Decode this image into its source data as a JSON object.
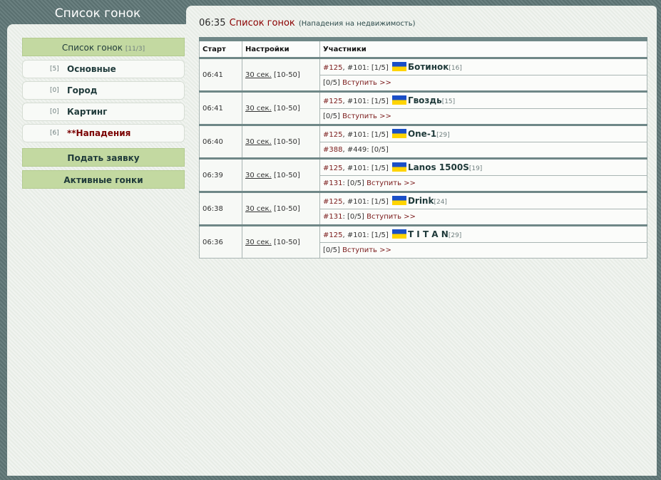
{
  "left_title": "Список гонок",
  "menu": {
    "race_list": {
      "label": "Список гонок",
      "count": "[11/3]"
    },
    "items": [
      {
        "count": "[5]",
        "label": "Основные"
      },
      {
        "count": "[0]",
        "label": "Город"
      },
      {
        "count": "[0]",
        "label": "Картинг"
      },
      {
        "count": "[6]",
        "label": "**Нападения"
      }
    ],
    "submit": "Подать заявку",
    "active": "Активные гонки"
  },
  "header": {
    "time": "06:35",
    "title": "Список гонок",
    "subtitle": "(Нападения на недвижимость)"
  },
  "table": {
    "columns": [
      "Старт",
      "Настройки",
      "Участники"
    ],
    "rows": [
      {
        "start": "06:41",
        "settings_link": "30 сек.",
        "settings_range": " [10-50]",
        "l1_a": "#125",
        "l1_b": ", #101: [1/5]",
        "nick": "Ботинок",
        "lvl": "[16]",
        "l2_slot": "",
        "l2_text": "[0/5]",
        "l2_join": " Вступить >>"
      },
      {
        "start": "06:41",
        "settings_link": "30 сек.",
        "settings_range": " [10-50]",
        "l1_a": "#125",
        "l1_b": ", #101: [1/5]",
        "nick": "Гвоздь",
        "lvl": "[15]",
        "l2_slot": "",
        "l2_text": "[0/5]",
        "l2_join": " Вступить >>"
      },
      {
        "start": "06:40",
        "settings_link": "30 сек.",
        "settings_range": " [10-50]",
        "l1_a": "#125",
        "l1_b": ", #101: [1/5]",
        "nick": "One-1",
        "lvl": "[29]",
        "l2_slot": "#388",
        "l2_text": ", #449: [0/5]",
        "l2_join": ""
      },
      {
        "start": "06:39",
        "settings_link": "30 сек.",
        "settings_range": " [10-50]",
        "l1_a": "#125",
        "l1_b": ", #101: [1/5]",
        "nick": "Lanos 1500S",
        "lvl": "[19]",
        "l2_slot": "#131",
        "l2_text": ": [0/5]",
        "l2_join": " Вступить >>"
      },
      {
        "start": "06:38",
        "settings_link": "30 сек.",
        "settings_range": " [10-50]",
        "l1_a": "#125",
        "l1_b": ", #101: [1/5]",
        "nick": "Drink",
        "lvl": "[24]",
        "l2_slot": "#131",
        "l2_text": ": [0/5]",
        "l2_join": " Вступить >>"
      },
      {
        "start": "06:36",
        "settings_link": "30 сек.",
        "settings_range": " [10-50]",
        "l1_a": "#125",
        "l1_b": ", #101: [1/5]",
        "nick": "T I T A N",
        "lvl": "[29]",
        "l2_slot": "",
        "l2_text": "[0/5]",
        "l2_join": " Вступить >>"
      }
    ]
  }
}
